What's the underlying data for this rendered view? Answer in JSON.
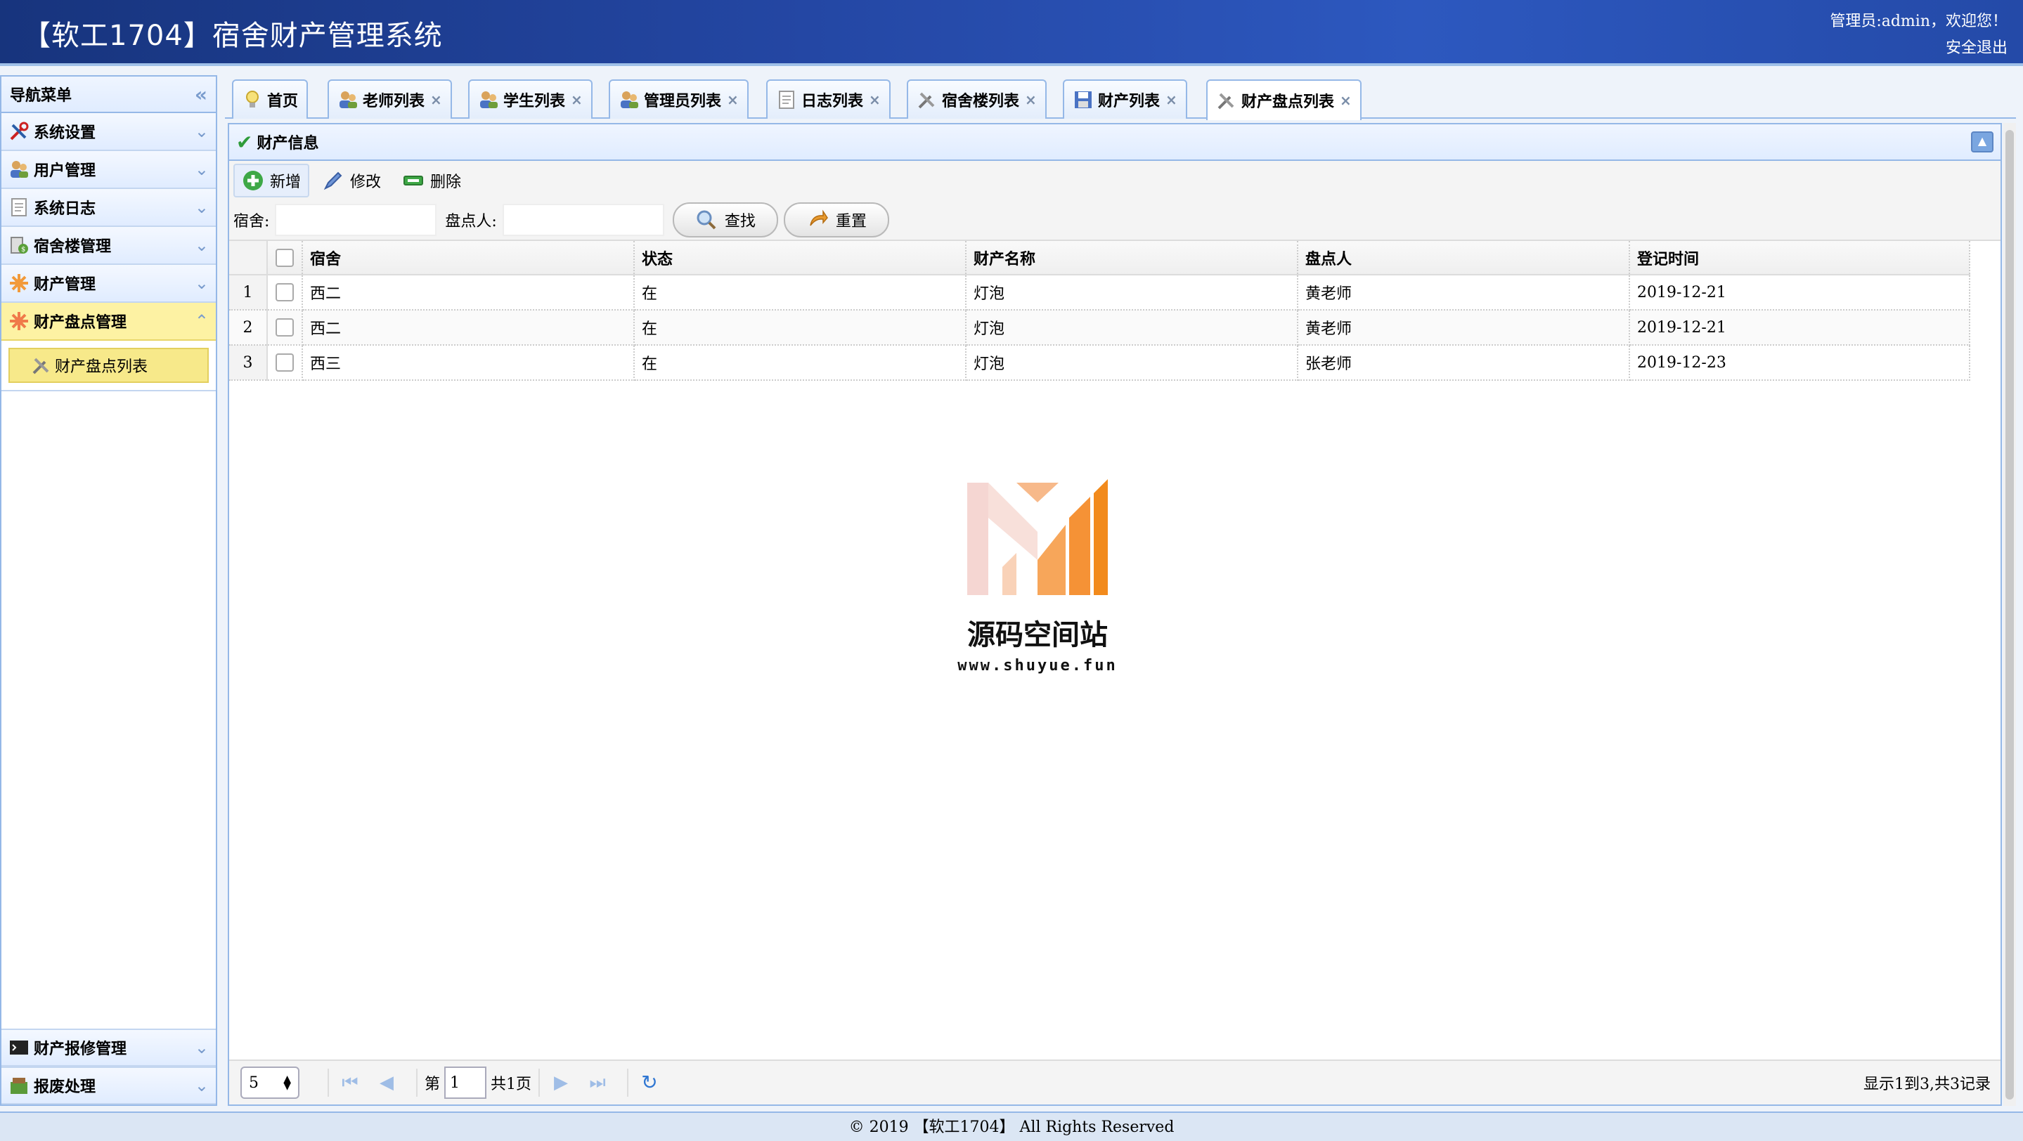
{
  "header": {
    "title": "【软工1704】宿舍财产管理系统",
    "user_text": "管理员:admin，欢迎您！",
    "logout_label": "安全退出"
  },
  "sidebar": {
    "title": "导航菜单",
    "items": [
      {
        "label": "系统设置",
        "icon": "tools-icon"
      },
      {
        "label": "用户管理",
        "icon": "users-icon"
      },
      {
        "label": "系统日志",
        "icon": "log-icon"
      },
      {
        "label": "宿舍楼管理",
        "icon": "building-icon"
      },
      {
        "label": "财产管理",
        "icon": "asset-icon"
      },
      {
        "label": "财产盘点管理",
        "icon": "inventory-icon",
        "expanded": true
      }
    ],
    "submenu_items": [
      {
        "label": "财产盘点列表",
        "icon": "tools-icon",
        "selected": true
      }
    ],
    "bottom_items": [
      {
        "label": "财产报修管理",
        "icon": "terminal-icon"
      },
      {
        "label": "报废处理",
        "icon": "scrap-icon"
      }
    ]
  },
  "tabs": [
    {
      "label": "首页",
      "icon": "bulb-icon",
      "closable": false
    },
    {
      "label": "老师列表",
      "icon": "users-icon",
      "closable": true
    },
    {
      "label": "学生列表",
      "icon": "users-icon",
      "closable": true
    },
    {
      "label": "管理员列表",
      "icon": "users-icon",
      "closable": true
    },
    {
      "label": "日志列表",
      "icon": "log-icon",
      "closable": true
    },
    {
      "label": "宿舍楼列表",
      "icon": "tools-icon",
      "closable": true
    },
    {
      "label": "财产列表",
      "icon": "save-icon",
      "closable": true
    },
    {
      "label": "财产盘点列表",
      "icon": "tools-icon",
      "closable": true,
      "active": true
    }
  ],
  "panel": {
    "title": "财产信息"
  },
  "toolbar": {
    "add_label": "新增",
    "edit_label": "修改",
    "delete_label": "删除"
  },
  "search": {
    "dorm_label": "宿舍:",
    "dorm_value": "",
    "checker_label": "盘点人:",
    "checker_value": "",
    "find_label": "查找",
    "reset_label": "重置"
  },
  "table": {
    "columns": [
      "宿舍",
      "状态",
      "财产名称",
      "盘点人",
      "登记时间"
    ],
    "rows": [
      {
        "num": "1",
        "cells": [
          "西二",
          "在",
          "灯泡",
          "黄老师",
          "2019-12-21"
        ]
      },
      {
        "num": "2",
        "cells": [
          "西二",
          "在",
          "灯泡",
          "黄老师",
          "2019-12-21"
        ]
      },
      {
        "num": "3",
        "cells": [
          "西三",
          "在",
          "灯泡",
          "张老师",
          "2019-12-23"
        ]
      }
    ]
  },
  "watermark": {
    "name": "源码空间站",
    "url": "www.shuyue.fun"
  },
  "pager": {
    "page_size": "5",
    "page_prefix": "第",
    "page_value": "1",
    "page_total": "共1页",
    "info": "显示1到3,共3记录"
  },
  "footer": {
    "text": "© 2019 【软工1704】 All Rights Reserved"
  },
  "colors": {
    "header_bg": "#2447a4",
    "border": "#95b8e7",
    "active_menu": "#fdf2a3",
    "watermark_orange": "#f28a1c"
  }
}
